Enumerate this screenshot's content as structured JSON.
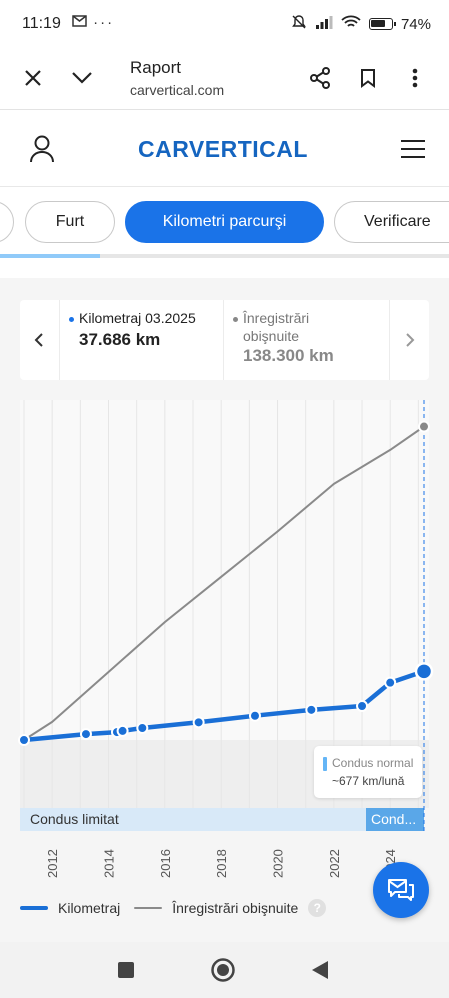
{
  "status_bar": {
    "time": "11:19",
    "left_icons": [
      "gmail-icon",
      "more-dots-icon"
    ],
    "battery": "74%",
    "battery_level": 0.74,
    "right_icons": [
      "mute-icon",
      "signal-icon",
      "wifi-icon",
      "battery-icon"
    ]
  },
  "browser": {
    "title": "Raport",
    "url": "carvertical.com",
    "icons": [
      "close-icon",
      "chevron-down-icon",
      "share-icon",
      "bookmark-icon",
      "more-vert-icon"
    ]
  },
  "site": {
    "logo": "CARVERTICAL",
    "icons": [
      "user-icon",
      "menu-icon"
    ]
  },
  "tabs": [
    {
      "label": "Furt",
      "active": false
    },
    {
      "label": "Kilometri parcurşi",
      "active": true
    },
    {
      "label": "Verificare",
      "active": false
    }
  ],
  "info": {
    "left": {
      "label": "Kilometraj 03.2025",
      "value": "37.686 km"
    },
    "right": {
      "label_line1": "Înregistrări",
      "label_line2": "obişnuite",
      "value": "138.300 km"
    }
  },
  "tooltip": {
    "line1": "Condus normal",
    "line2": "~677 km/lună"
  },
  "bands": {
    "left": "Condus limitat",
    "right": "Cond..."
  },
  "legend": {
    "series1": "Kilometraj",
    "series2": "Înregistrări obişnuite",
    "help": "?"
  },
  "colors": {
    "accent": "#1a73e8",
    "mileage_line": "#1a6fd6",
    "average_line": "#8a8a8a",
    "band_limited": "#d8e9f8",
    "band_normal": "#5aa7e8"
  },
  "chart_data": {
    "type": "line",
    "x_ticks": [
      "2012",
      "2014",
      "2016",
      "2018",
      "2020",
      "2022",
      "2024"
    ],
    "xlim": [
      2011.0,
      2025.2
    ],
    "ylim": [
      0,
      150000
    ],
    "grid": true,
    "legend_position": "bottom",
    "series": [
      {
        "name": "Kilometraj",
        "x": [
          2011.0,
          2013.2,
          2014.3,
          2014.5,
          2015.2,
          2017.2,
          2019.2,
          2021.2,
          2023.0,
          2024.0,
          2025.2
        ],
        "y": [
          0,
          2600,
          3500,
          4000,
          5300,
          7800,
          10700,
          13300,
          15000,
          25300,
          30300
        ],
        "markers": true
      },
      {
        "name": "Înregistrări obişnuite",
        "x": [
          2011.0,
          2012.0,
          2014.0,
          2016.0,
          2018.0,
          2020.0,
          2022.0,
          2024.0,
          2025.2
        ],
        "y": [
          0,
          8000,
          30000,
          52000,
          72000,
          92000,
          113000,
          128000,
          138300
        ],
        "markers": false
      }
    ]
  }
}
